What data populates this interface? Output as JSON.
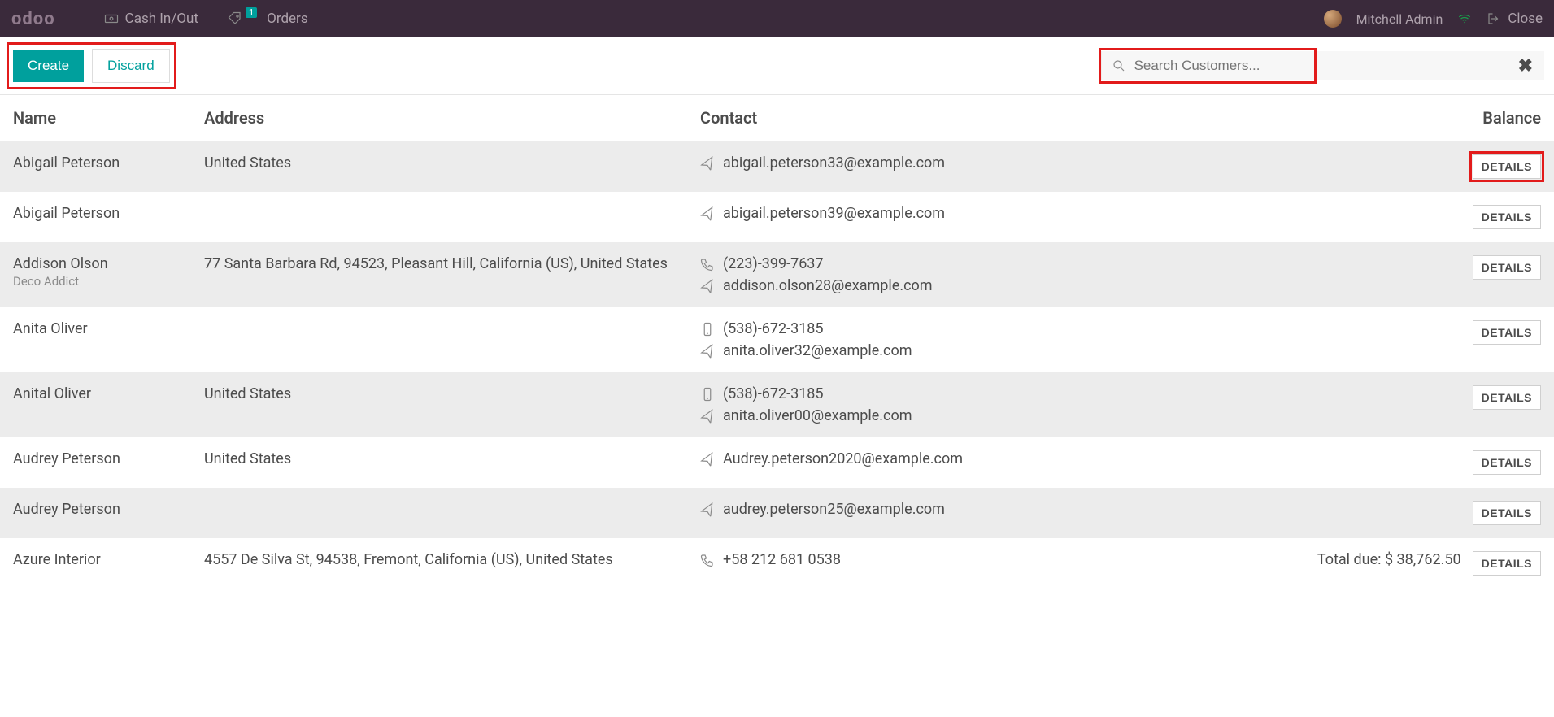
{
  "topbar": {
    "logo": "odoo",
    "cash_link": "Cash In/Out",
    "orders_link": "Orders",
    "orders_badge": "1",
    "user_name": "Mitchell Admin",
    "close_label": "Close"
  },
  "toolbar": {
    "create_label": "Create",
    "discard_label": "Discard",
    "search_placeholder": "Search Customers..."
  },
  "columns": {
    "name": "Name",
    "address": "Address",
    "contact": "Contact",
    "balance": "Balance"
  },
  "customers": [
    {
      "name": "Abigail Peterson",
      "sub": "",
      "address": "United States",
      "phone": "",
      "email": "abigail.peterson33@example.com",
      "balance": "",
      "phone_icon": "",
      "details": "DETAILS",
      "highlight_details": true
    },
    {
      "name": "Abigail Peterson",
      "sub": "",
      "address": "",
      "phone": "",
      "email": "abigail.peterson39@example.com",
      "balance": "",
      "phone_icon": "",
      "details": "DETAILS"
    },
    {
      "name": "Addison Olson",
      "sub": "Deco Addict",
      "address": "77 Santa Barbara Rd, 94523, Pleasant Hill, California (US), United States",
      "phone": "(223)-399-7637",
      "email": "addison.olson28@example.com",
      "balance": "",
      "phone_icon": "phone",
      "details": "DETAILS"
    },
    {
      "name": "Anita Oliver",
      "sub": "",
      "address": "",
      "phone": "(538)-672-3185",
      "email": "anita.oliver32@example.com",
      "balance": "",
      "phone_icon": "mobile",
      "details": "DETAILS"
    },
    {
      "name": "Anital Oliver",
      "sub": "",
      "address": "United States",
      "phone": "(538)-672-3185",
      "email": "anita.oliver00@example.com",
      "balance": "",
      "phone_icon": "mobile",
      "details": "DETAILS"
    },
    {
      "name": "Audrey Peterson",
      "sub": "",
      "address": "United States",
      "phone": "",
      "email": "Audrey.peterson2020@example.com",
      "balance": "",
      "phone_icon": "",
      "details": "DETAILS"
    },
    {
      "name": "Audrey Peterson",
      "sub": "",
      "address": "",
      "phone": "",
      "email": "audrey.peterson25@example.com",
      "balance": "",
      "phone_icon": "",
      "details": "DETAILS"
    },
    {
      "name": "Azure Interior",
      "sub": "",
      "address": "4557 De Silva St, 94538, Fremont, California (US), United States",
      "phone": "+58 212 681 0538",
      "email": "",
      "balance": "Total due: $ 38,762.50",
      "phone_icon": "phone",
      "details": "DETAILS"
    }
  ]
}
